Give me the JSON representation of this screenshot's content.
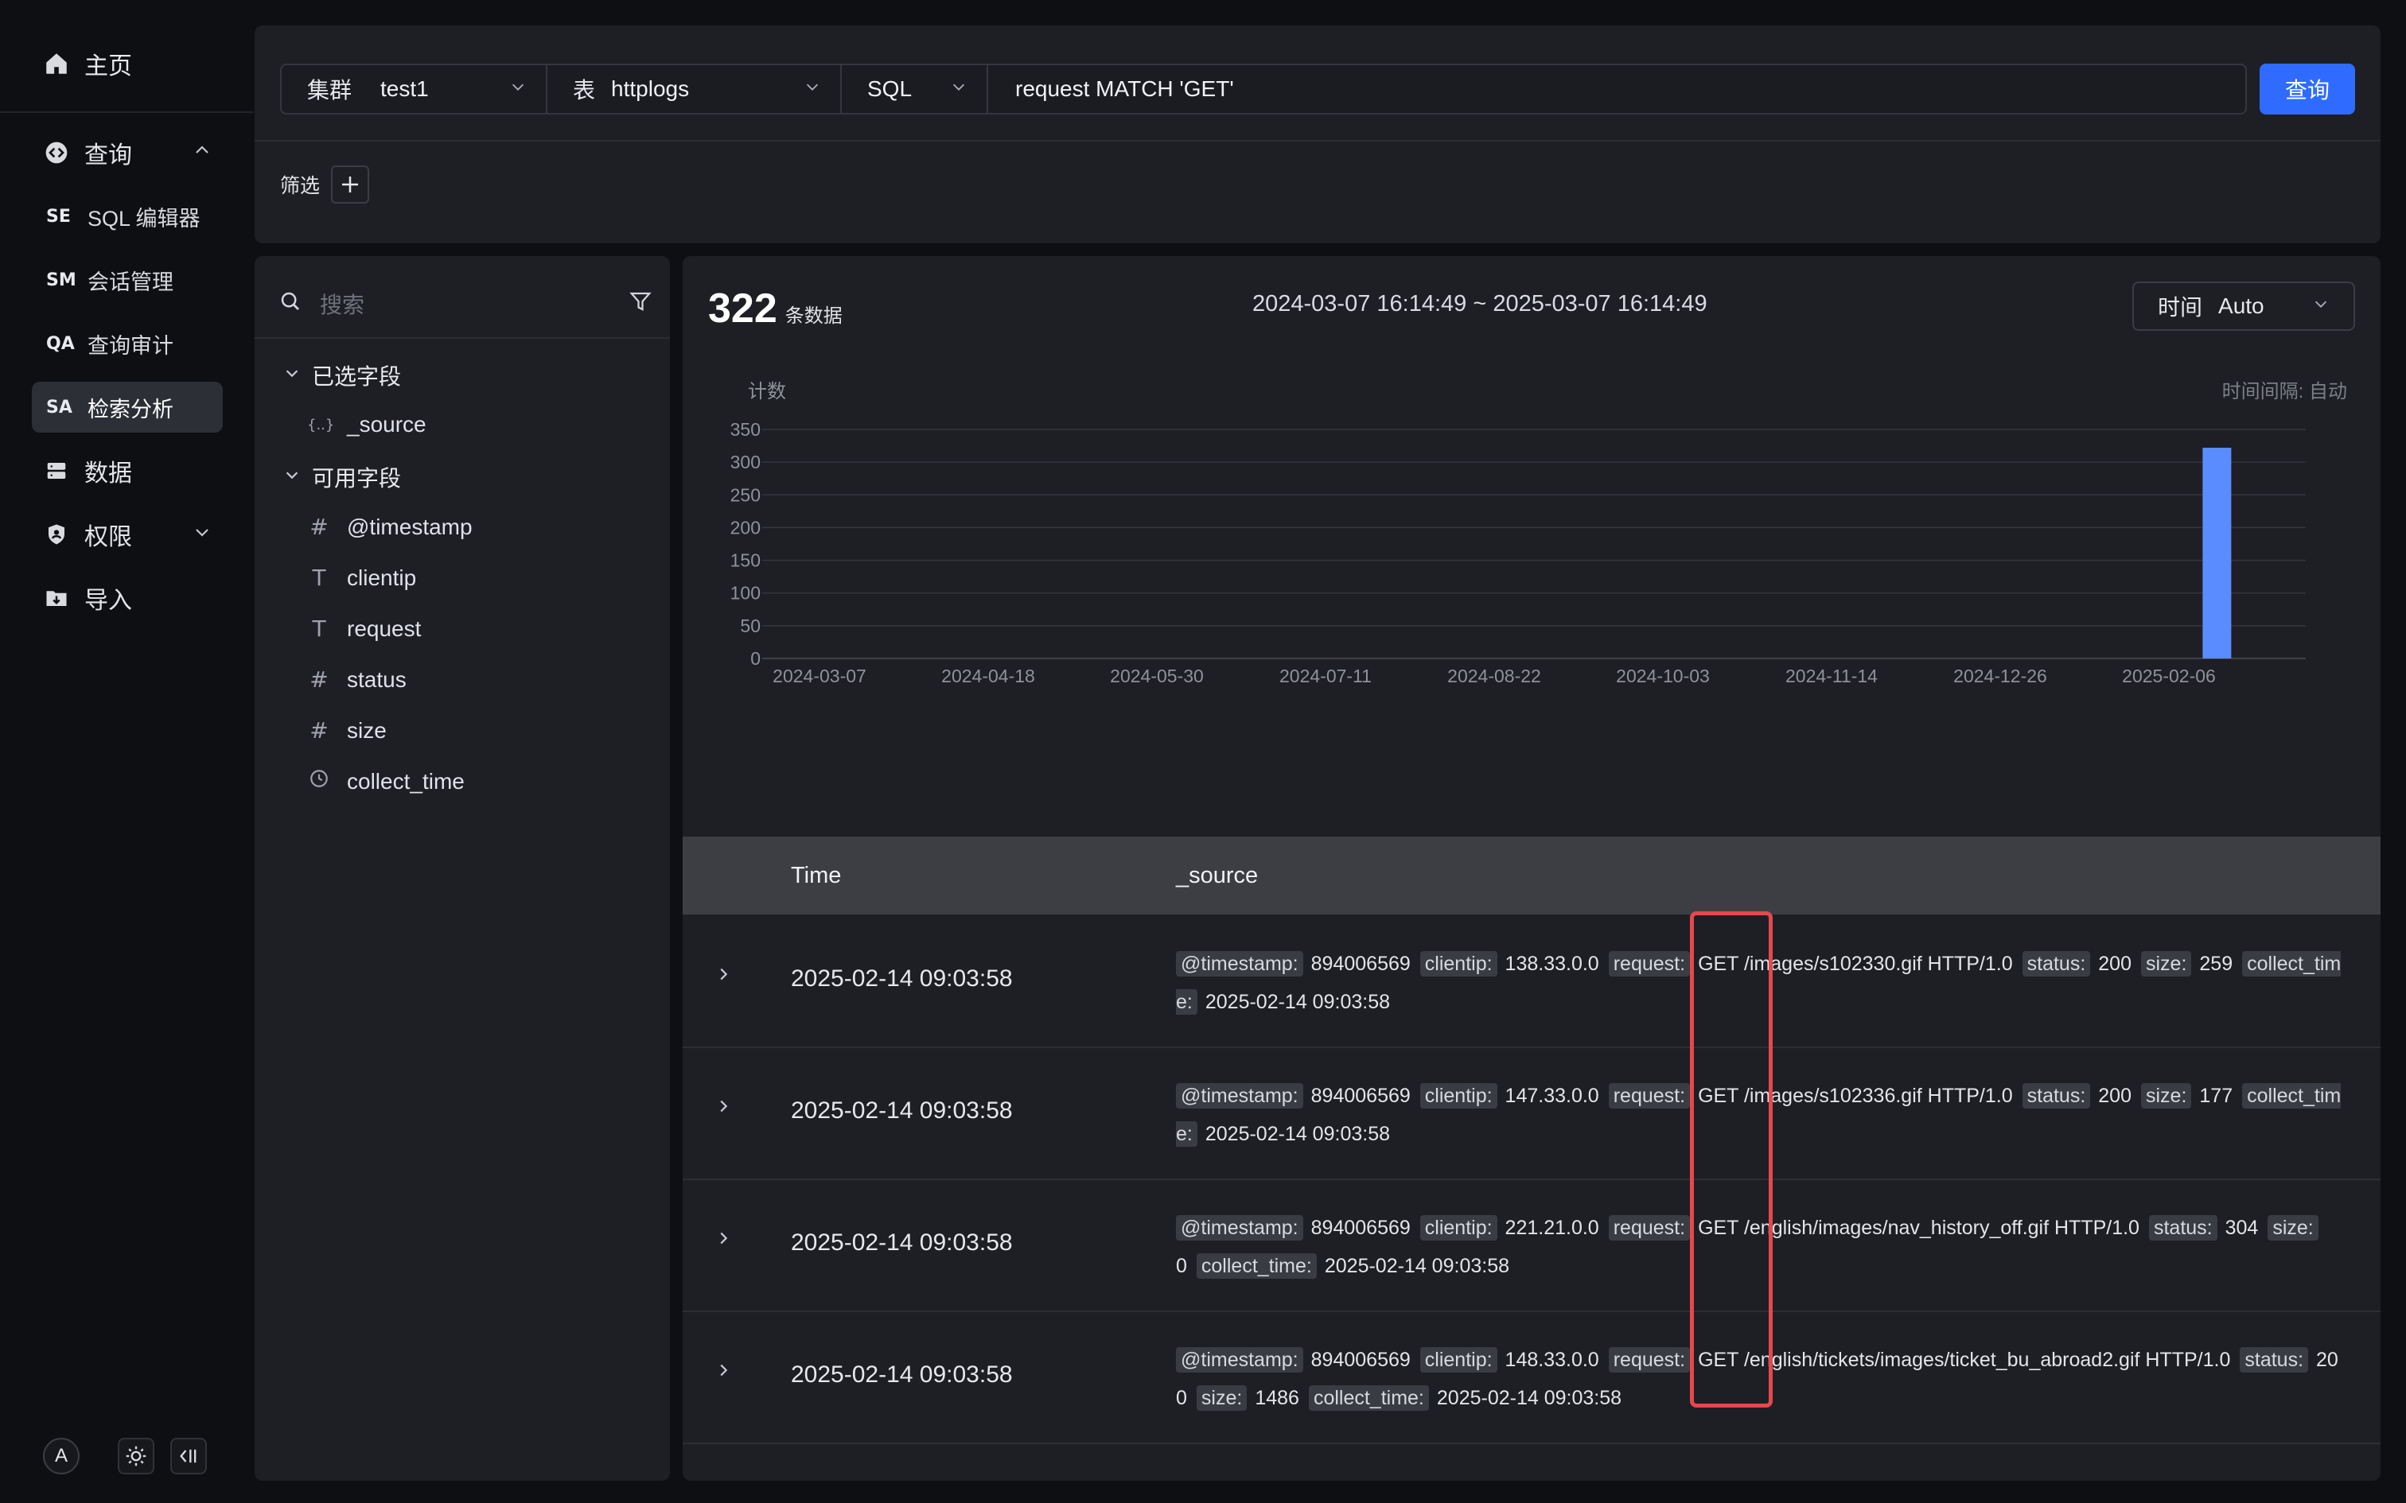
{
  "sidebar": {
    "home": "主页",
    "query": "查询",
    "sub_items": [
      {
        "abbr": "SE",
        "label": "SQL 编辑器"
      },
      {
        "abbr": "SM",
        "label": "会话管理"
      },
      {
        "abbr": "QA",
        "label": "查询审计"
      },
      {
        "abbr": "SA",
        "label": "检索分析"
      }
    ],
    "data": "数据",
    "permissions": "权限",
    "import": "导入",
    "avatar_letter": "A"
  },
  "query_bar": {
    "cluster_label": "集群",
    "cluster_value": "test1",
    "table_label": "表",
    "table_value": "httplogs",
    "mode_value": "SQL",
    "query_text": "request MATCH 'GET'",
    "submit_label": "查询",
    "filter_label": "筛选",
    "add_filter": "+"
  },
  "field_panel": {
    "search_placeholder": "搜索",
    "selected_group": "已选字段",
    "selected_fields": [
      {
        "type_icon": "{..}",
        "name": "_source"
      }
    ],
    "available_group": "可用字段",
    "available_fields": [
      {
        "type_icon": "#",
        "name": "@timestamp"
      },
      {
        "type_icon": "T",
        "name": "clientip"
      },
      {
        "type_icon": "T",
        "name": "request"
      },
      {
        "type_icon": "#",
        "name": "status"
      },
      {
        "type_icon": "#",
        "name": "size"
      },
      {
        "type_icon": "clock",
        "name": "collect_time"
      }
    ]
  },
  "results": {
    "count": "322",
    "count_unit": "条数据",
    "time_range": "2024-03-07 16:14:49 ~ 2025-03-07 16:14:49",
    "time_select_label": "时间",
    "time_select_value": "Auto",
    "columns": [
      "Time",
      "_source"
    ],
    "rows": [
      {
        "time": "2025-02-14 09:03:58",
        "fields": [
          {
            "k": "@timestamp:",
            "v": "894006569"
          },
          {
            "k": "clientip:",
            "v": "138.33.0.0"
          },
          {
            "k": "request:",
            "v": "GET /images/s102330.gif HTTP/1.0"
          },
          {
            "k": "status:",
            "v": "200"
          },
          {
            "k": "size:",
            "v": "259"
          },
          {
            "k": "collect_time:",
            "v": "2025-02-14 09:03:58"
          }
        ]
      },
      {
        "time": "2025-02-14 09:03:58",
        "fields": [
          {
            "k": "@timestamp:",
            "v": "894006569"
          },
          {
            "k": "clientip:",
            "v": "147.33.0.0"
          },
          {
            "k": "request:",
            "v": "GET /images/s102336.gif HTTP/1.0"
          },
          {
            "k": "status:",
            "v": "200"
          },
          {
            "k": "size:",
            "v": "177"
          },
          {
            "k": "collect_time:",
            "v": "2025-02-14 09:03:58"
          }
        ]
      },
      {
        "time": "2025-02-14 09:03:58",
        "fields": [
          {
            "k": "@timestamp:",
            "v": "894006569"
          },
          {
            "k": "clientip:",
            "v": "221.21.0.0"
          },
          {
            "k": "request:",
            "v": "GET /english/images/nav_history_off.gif HTTP/1.0"
          },
          {
            "k": "status:",
            "v": "304"
          },
          {
            "k": "size:",
            "v": "0"
          },
          {
            "k": "collect_time:",
            "v": "2025-02-14 09:03:58"
          }
        ]
      },
      {
        "time": "2025-02-14 09:03:58",
        "fields": [
          {
            "k": "@timestamp:",
            "v": "894006569"
          },
          {
            "k": "clientip:",
            "v": "148.33.0.0"
          },
          {
            "k": "request:",
            "v": "GET /english/tickets/images/ticket_bu_abroad2.gif HTTP/1.0"
          },
          {
            "k": "status:",
            "v": "200"
          },
          {
            "k": "size:",
            "v": "1486"
          },
          {
            "k": "collect_time:",
            "v": "2025-02-14 09:03:58"
          }
        ]
      }
    ]
  },
  "colors": {
    "accent": "#2f6bff",
    "bar": "#5b8cff",
    "highlight": "#e5484d"
  },
  "chart_data": {
    "type": "bar",
    "title": "",
    "ylabel": "计数",
    "interval_label": "时间间隔: 自动",
    "x_ticks": [
      "2024-03-07",
      "2024-04-18",
      "2024-05-30",
      "2024-07-11",
      "2024-08-22",
      "2024-10-03",
      "2024-11-14",
      "2024-12-26",
      "2025-02-06"
    ],
    "y_ticks": [
      0,
      50,
      100,
      150,
      200,
      250,
      300,
      350
    ],
    "ylim": [
      0,
      350
    ],
    "x_range": [
      "2024-03-07",
      "2025-03-07"
    ],
    "bars": [
      {
        "x": "2025-02-14",
        "value": 322
      }
    ],
    "grid": true
  }
}
